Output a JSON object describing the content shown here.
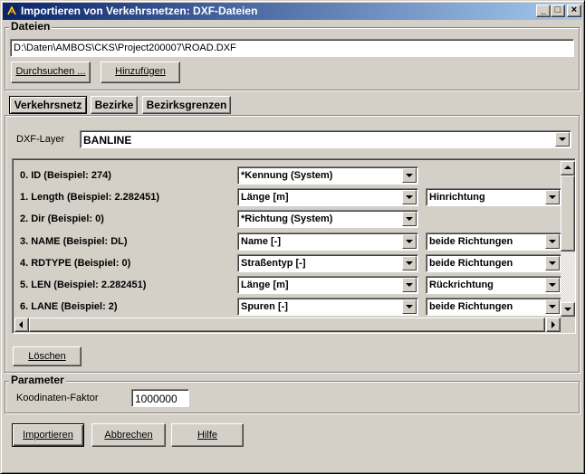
{
  "window": {
    "title": "Importieren von Verkehrsnetzen: DXF-Dateien",
    "minimize": "_",
    "maximize": "□",
    "close": "×"
  },
  "dateien": {
    "group_label": "Dateien",
    "path_value": "D:\\Daten\\AMBOS\\CKS\\Project200007\\ROAD.DXF",
    "browse_label": "Durchsuchen ...",
    "add_label": "Hinzufügen"
  },
  "tabs": [
    {
      "label": "Verkehrsnetz",
      "active": true
    },
    {
      "label": "Bezirke",
      "active": false
    },
    {
      "label": "Bezirksgrenzen",
      "active": false
    }
  ],
  "dxf_layer": {
    "label": "DXF-Layer",
    "value": "BANLINE"
  },
  "attributes": [
    {
      "label": "0. ID (Beispiel: 274)",
      "mapping": "*Kennung (System)",
      "direction": ""
    },
    {
      "label": "1. Length (Beispiel: 2.282451)",
      "mapping": "Länge [m]",
      "direction": "Hinrichtung"
    },
    {
      "label": "2. Dir (Beispiel: 0)",
      "mapping": "*Richtung (System)",
      "direction": ""
    },
    {
      "label": "3. NAME (Beispiel: DL)",
      "mapping": "Name [-]",
      "direction": "beide Richtungen"
    },
    {
      "label": "4. RDTYPE (Beispiel: 0)",
      "mapping": "Straßentyp [-]",
      "direction": "beide Richtungen"
    },
    {
      "label": "5. LEN (Beispiel: 2.282451)",
      "mapping": "Länge [m]",
      "direction": "Rückrichtung"
    },
    {
      "label": "6. LANE (Beispiel: 2)",
      "mapping": "Spuren [-]",
      "direction": "beide Richtungen"
    }
  ],
  "delete_label": "Löschen",
  "parameter": {
    "group_label": "Parameter",
    "factor_label": "Koodinaten-Faktor",
    "factor_value": "1000000"
  },
  "footer": {
    "import_label": "Importieren",
    "cancel_label": "Abbrechen",
    "help_label": "Hilfe"
  }
}
